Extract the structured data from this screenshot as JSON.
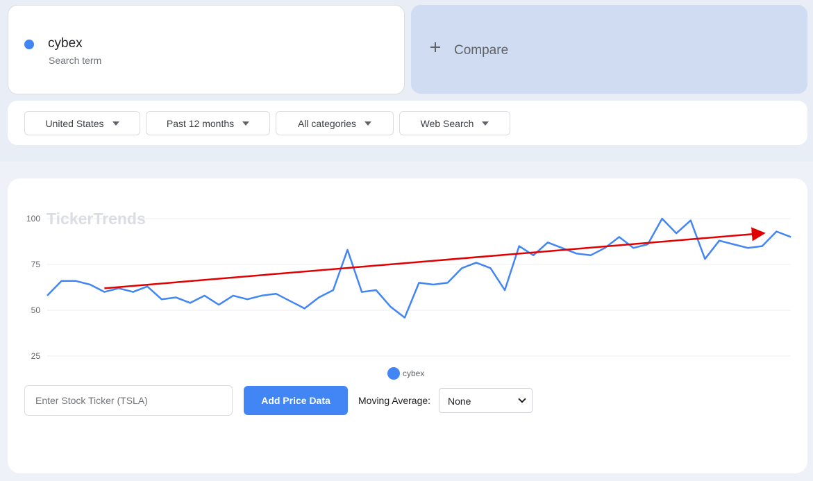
{
  "search_term": {
    "name": "cybex",
    "subtitle": "Search term",
    "color": "#4285f4"
  },
  "compare": {
    "label": "Compare",
    "icon": "plus-icon"
  },
  "filters": {
    "region": "United States",
    "time_range": "Past 12 months",
    "category": "All categories",
    "search_type": "Web Search"
  },
  "watermark": "TickerTrends",
  "chart_data": {
    "type": "line",
    "series": [
      {
        "name": "cybex",
        "color": "#4285f4",
        "values": [
          58,
          66,
          66,
          64,
          60,
          62,
          60,
          63,
          56,
          57,
          54,
          58,
          53,
          58,
          56,
          58,
          59,
          55,
          51,
          57,
          61,
          83,
          60,
          61,
          52,
          46,
          65,
          64,
          65,
          73,
          76,
          73,
          61,
          85,
          80,
          87,
          84,
          81,
          80,
          84,
          90,
          84,
          86,
          100,
          92,
          99,
          78,
          88,
          86,
          84,
          85,
          93,
          90
        ]
      }
    ],
    "y_ticks": [
      "100",
      "75",
      "50",
      "25"
    ],
    "ylim": [
      25,
      100
    ],
    "grid": true,
    "annotation": {
      "type": "trend-arrow",
      "color": "#e00000",
      "from": {
        "index": 4,
        "value": 62
      },
      "to": {
        "index": 50,
        "value": 92
      }
    },
    "legend": {
      "label": "cybex",
      "placement": "bottom-center"
    }
  },
  "stock_input": {
    "placeholder": "Enter Stock Ticker (TSLA)",
    "value": ""
  },
  "add_button": {
    "label": "Add Price Data"
  },
  "moving_average": {
    "label": "Moving Average:",
    "selected": "None"
  }
}
